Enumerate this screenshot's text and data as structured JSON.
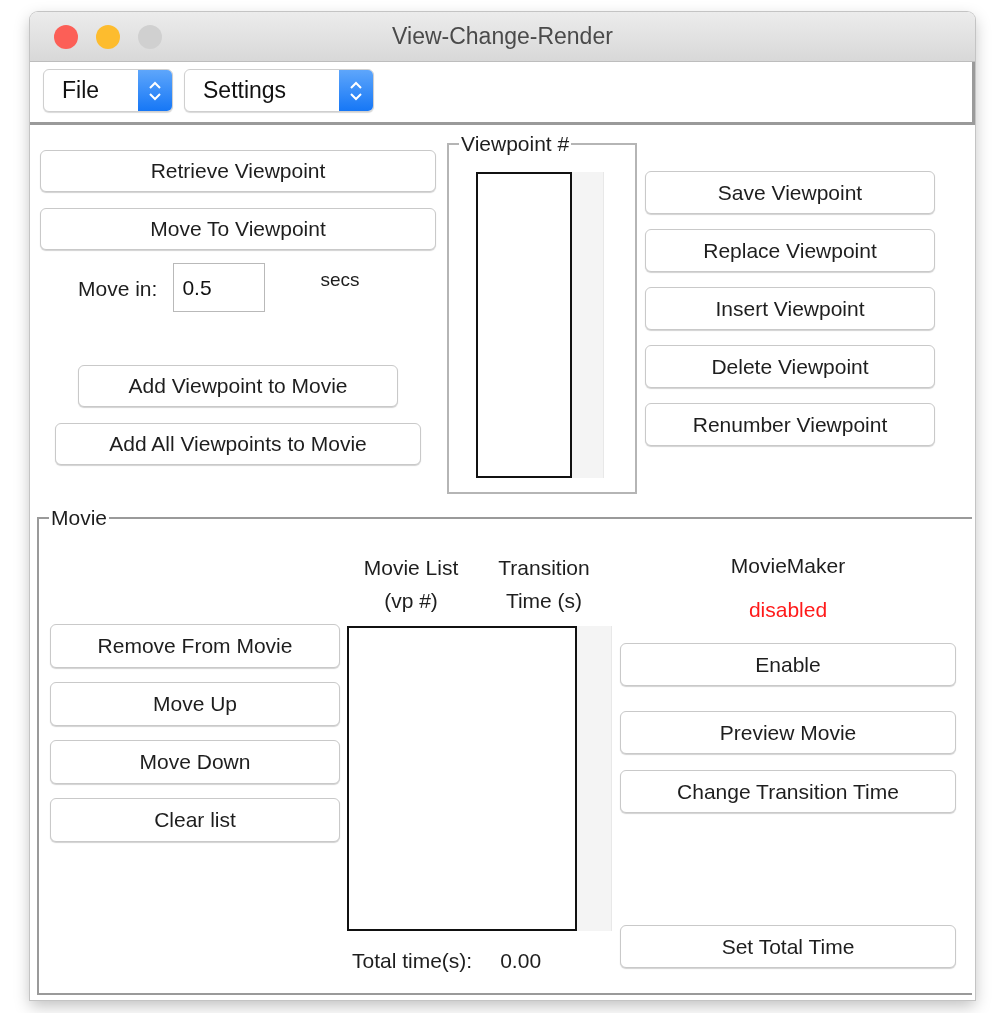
{
  "window": {
    "title": "View-Change-Render"
  },
  "toolbar": {
    "menus": [
      {
        "label": "File"
      },
      {
        "label": "Settings"
      }
    ]
  },
  "viewpoints": {
    "left_buttons": [
      {
        "label": "Retrieve Viewpoint"
      },
      {
        "label": "Move To Viewpoint"
      }
    ],
    "move_in": {
      "label": "Move in:",
      "value": "0.5",
      "unit": "secs"
    },
    "add_buttons": [
      {
        "label": "Add Viewpoint to Movie"
      },
      {
        "label": "Add All Viewpoints to Movie"
      }
    ],
    "list": {
      "title": "Viewpoint #"
    },
    "right_buttons": [
      {
        "label": "Save Viewpoint"
      },
      {
        "label": "Replace Viewpoint"
      },
      {
        "label": "Insert Viewpoint"
      },
      {
        "label": "Delete Viewpoint"
      },
      {
        "label": "Renumber Viewpoint"
      }
    ]
  },
  "movie": {
    "title": "Movie",
    "buttons": [
      {
        "label": "Remove From Movie"
      },
      {
        "label": "Move Up"
      },
      {
        "label": "Move Down"
      },
      {
        "label": "Clear list"
      }
    ],
    "list_headers": [
      "Movie List (vp #)",
      "Transition Time (s)"
    ],
    "total": {
      "label": "Total time(s):",
      "value": "0.00"
    },
    "movie_maker": {
      "title": "MovieMaker",
      "status": "disabled"
    },
    "maker_buttons": [
      {
        "label": "Enable"
      },
      {
        "label": "Preview Movie"
      },
      {
        "label": "Change Transition Time"
      }
    ],
    "set_total_button": {
      "label": "Set Total Time"
    }
  }
}
